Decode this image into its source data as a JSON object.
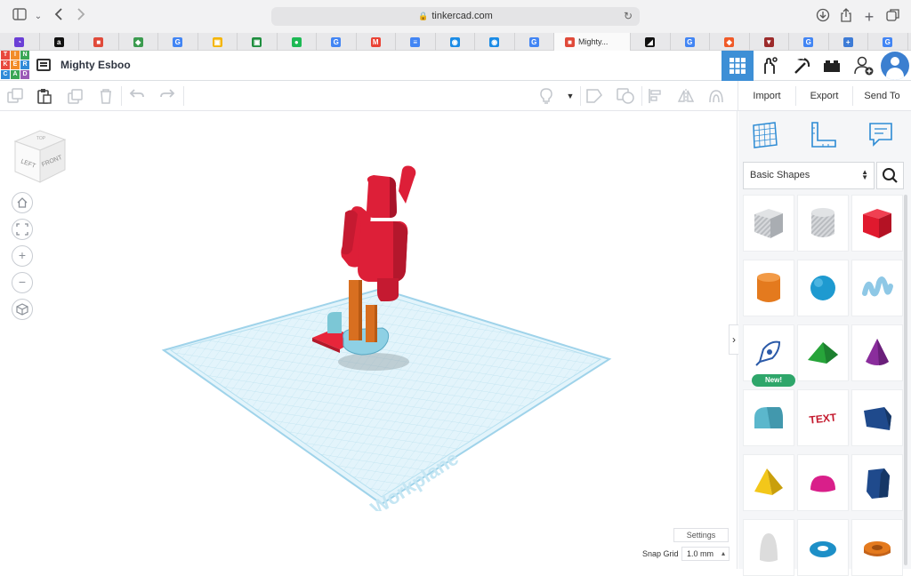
{
  "browser": {
    "url": "tinkercad.com",
    "tabs": [
      {
        "icon": "purple-app-favicon",
        "color": "#6b3fd6",
        "glyph": "◔",
        "active": false
      },
      {
        "icon": "amazon-favicon",
        "color": "#111111",
        "glyph": "a",
        "active": false
      },
      {
        "icon": "colorful-grid-favicon",
        "color": "#e04a3a",
        "glyph": "■",
        "active": false
      },
      {
        "icon": "green-cube-favicon",
        "color": "#3b9b4f",
        "glyph": "◆",
        "active": false
      },
      {
        "icon": "google-favicon",
        "color": "#4285f4",
        "glyph": "G",
        "active": false
      },
      {
        "icon": "slides-favicon",
        "color": "#f4b400",
        "glyph": "▣",
        "active": false
      },
      {
        "icon": "classroom-favicon",
        "color": "#1e8e3e",
        "glyph": "▣",
        "active": false
      },
      {
        "icon": "spotify-favicon",
        "color": "#1db954",
        "glyph": "●",
        "active": false
      },
      {
        "icon": "google-favicon",
        "color": "#4285f4",
        "glyph": "G",
        "active": false
      },
      {
        "icon": "gmail-favicon",
        "color": "#ea4335",
        "glyph": "M",
        "active": false
      },
      {
        "icon": "docs-favicon",
        "color": "#4285f4",
        "glyph": "≡",
        "active": false
      },
      {
        "icon": "blue-app-favicon",
        "color": "#1a8be6",
        "glyph": "◉",
        "active": false
      },
      {
        "icon": "blue-app-favicon",
        "color": "#1a8be6",
        "glyph": "◉",
        "active": false
      },
      {
        "icon": "google-favicon",
        "color": "#4285f4",
        "glyph": "G",
        "active": false
      },
      {
        "icon": "tinkercad-favicon",
        "color": "#e04a3a",
        "glyph": "■",
        "active": true,
        "label": "Mighty..."
      },
      {
        "icon": "dark-swoosh-favicon",
        "color": "#111111",
        "glyph": "◢",
        "active": false
      },
      {
        "icon": "google-favicon",
        "color": "#4285f4",
        "glyph": "G",
        "active": false
      },
      {
        "icon": "orange-app-favicon",
        "color": "#f05a28",
        "glyph": "◆",
        "active": false
      },
      {
        "icon": "crest-favicon",
        "color": "#9c2b2b",
        "glyph": "▼",
        "active": false
      },
      {
        "icon": "google-favicon",
        "color": "#4285f4",
        "glyph": "G",
        "active": false
      },
      {
        "icon": "plus-favicon",
        "color": "#3d7bd6",
        "glyph": "+",
        "active": false
      },
      {
        "icon": "google-favicon",
        "color": "#4285f4",
        "glyph": "G",
        "active": false
      }
    ]
  },
  "header": {
    "logo_letters": [
      "T",
      "I",
      "N",
      "K",
      "E",
      "R",
      "C",
      "A",
      "D"
    ],
    "logo_colors": [
      "#e8483d",
      "#f28c28",
      "#3aa655",
      "#e8483d",
      "#f28c28",
      "#2f8bd8",
      "#2f8bd8",
      "#3aa655",
      "#9b59b6"
    ],
    "design_title": "Mighty Esboo",
    "buttons": [
      {
        "name": "3d-view-button",
        "icon": "grid-icon",
        "active": true
      },
      {
        "name": "blocks-button",
        "icon": "circuit-hand-icon",
        "active": false
      },
      {
        "name": "codeblocks-button",
        "icon": "pickaxe-icon",
        "active": false
      },
      {
        "name": "bricks-button",
        "icon": "brick-icon",
        "active": false
      },
      {
        "name": "invite-button",
        "icon": "add-user-icon",
        "active": false
      }
    ],
    "accent": "#3d8fd6"
  },
  "toolbar": {
    "import_label": "Import",
    "export_label": "Export",
    "send_to_label": "Send To"
  },
  "workspace": {
    "workplane_label": "Workplane",
    "viewcube_left": "LEFT",
    "viewcube_front": "FRONT",
    "settings_label": "Settings",
    "snap_grid_label": "Snap Grid",
    "snap_grid_value": "1.0 mm"
  },
  "panel": {
    "category": "Basic Shapes",
    "new_badge": "New!",
    "shapes": [
      "box-hole",
      "cylinder-hole",
      "box",
      "cylinder",
      "sphere",
      "scribble",
      "shape-generator",
      "roof",
      "cone",
      "round-roof",
      "text",
      "wedge",
      "pyramid",
      "half-sphere",
      "polygon",
      "paraboloid",
      "torus",
      "tube"
    ]
  }
}
